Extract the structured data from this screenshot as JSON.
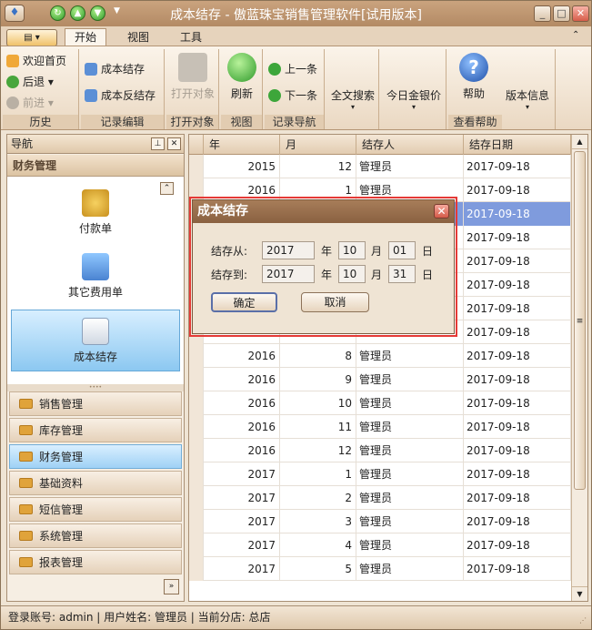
{
  "window": {
    "title": "成本结存 - 傲蓝珠宝销售管理软件[试用版本]"
  },
  "tabs": [
    "开始",
    "视图",
    "工具"
  ],
  "ribbon": {
    "history": {
      "label": "历史",
      "home": "欢迎首页",
      "back": "后退",
      "forward": "前进"
    },
    "record_edit": {
      "label": "记录编辑",
      "cost_close": "成本结存",
      "cost_reverse": "成本反结存"
    },
    "open_obj": {
      "label": "打开对象",
      "open": "打开对象"
    },
    "view": {
      "label": "视图",
      "refresh": "刷新"
    },
    "record_nav": {
      "label": "记录导航",
      "prev": "上一条",
      "next": "下一条"
    },
    "search": {
      "label": "全文搜索"
    },
    "gold": {
      "label": "今日金银价"
    },
    "help": {
      "label": "查看帮助",
      "help": "帮助",
      "version": "版本信息"
    }
  },
  "nav": {
    "title": "导航",
    "section": "财务管理",
    "items": [
      "付款单",
      "其它费用单",
      "成本结存"
    ],
    "categories": [
      "销售管理",
      "库存管理",
      "财务管理",
      "基础资料",
      "短信管理",
      "系统管理",
      "报表管理"
    ]
  },
  "grid": {
    "headers": [
      "年",
      "月",
      "结存人",
      "结存日期"
    ],
    "rows": [
      [
        "2015",
        "12",
        "管理员",
        "2017-09-18"
      ],
      [
        "2016",
        "1",
        "管理员",
        "2017-09-18"
      ],
      [
        "",
        "",
        "",
        "2017-09-18"
      ],
      [
        "",
        "",
        "",
        "2017-09-18"
      ],
      [
        "",
        "",
        "",
        "2017-09-18"
      ],
      [
        "",
        "",
        "",
        "2017-09-18"
      ],
      [
        "",
        "",
        "",
        "2017-09-18"
      ],
      [
        "",
        "",
        "",
        "2017-09-18"
      ],
      [
        "2016",
        "8",
        "管理员",
        "2017-09-18"
      ],
      [
        "2016",
        "9",
        "管理员",
        "2017-09-18"
      ],
      [
        "2016",
        "10",
        "管理员",
        "2017-09-18"
      ],
      [
        "2016",
        "11",
        "管理员",
        "2017-09-18"
      ],
      [
        "2016",
        "12",
        "管理员",
        "2017-09-18"
      ],
      [
        "2017",
        "1",
        "管理员",
        "2017-09-18"
      ],
      [
        "2017",
        "2",
        "管理员",
        "2017-09-18"
      ],
      [
        "2017",
        "3",
        "管理员",
        "2017-09-18"
      ],
      [
        "2017",
        "4",
        "管理员",
        "2017-09-18"
      ],
      [
        "2017",
        "5",
        "管理员",
        "2017-09-18"
      ]
    ]
  },
  "dialog": {
    "title": "成本结存",
    "from_label": "结存从:",
    "to_label": "结存到:",
    "from": {
      "year": "2017",
      "month": "10",
      "day": "01"
    },
    "to": {
      "year": "2017",
      "month": "10",
      "day": "31"
    },
    "year_unit": "年",
    "month_unit": "月",
    "day_unit": "日",
    "ok": "确定",
    "cancel": "取消"
  },
  "status": {
    "text": "登录账号: admin  |  用户姓名: 管理员  |  当前分店: 总店"
  },
  "colors": {
    "accent": "#b38a64",
    "selected_row": "#7f9bdd",
    "highlight": "#e53a36"
  }
}
